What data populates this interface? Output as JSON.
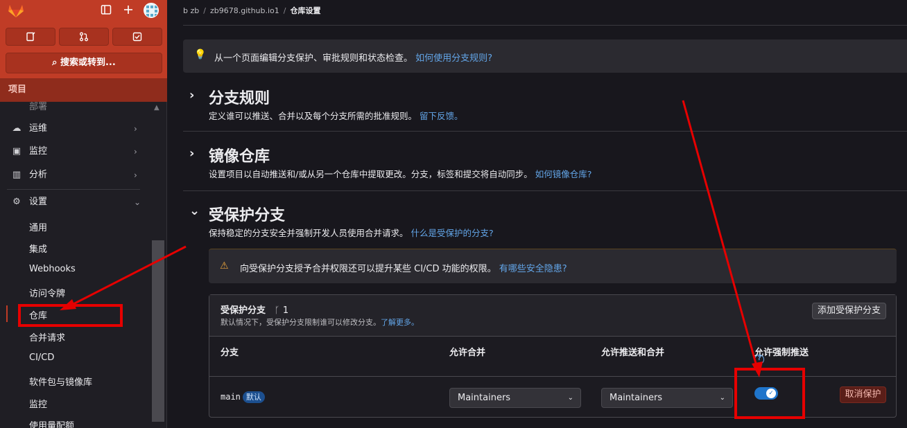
{
  "topbar": {
    "search_label": "搜索或转到...",
    "project_header": "项目"
  },
  "sidebar": {
    "cut_item": "部署",
    "items": [
      {
        "label": "运维",
        "icon": "cloud-ops-icon"
      },
      {
        "label": "监控",
        "icon": "monitor-icon"
      },
      {
        "label": "分析",
        "icon": "chart-icon"
      },
      {
        "label": "设置",
        "icon": "gear-icon"
      }
    ],
    "settings_sub": [
      "通用",
      "集成",
      "Webhooks",
      "访问令牌",
      "仓库",
      "合并请求",
      "CI/CD",
      "软件包与镜像库",
      "监控",
      "使用量配额"
    ],
    "active_sub": "仓库"
  },
  "breadcrumb": {
    "items": [
      "b zb",
      "zb9678.github.io1",
      "仓库设置"
    ]
  },
  "info_banner": {
    "text": "从一个页面编辑分支保护、审批规则和状态检查。",
    "link": "如何使用分支规则?"
  },
  "sections": {
    "branch_rules": {
      "title": "分支规则",
      "desc": "定义谁可以推送、合并以及每个分支所需的批准规则。",
      "link": "留下反馈。"
    },
    "mirror": {
      "title": "镜像仓库",
      "desc": "设置项目以自动推送和/或从另一个仓库中提取更改。分支，标签和提交将自动同步。",
      "link": "如何镜像仓库?"
    },
    "protected": {
      "title": "受保护分支",
      "desc": "保持稳定的分支安全并强制开发人员使用合并请求。",
      "link": "什么是受保护的分支?"
    }
  },
  "warning": {
    "text": "向受保护分支授予合并权限还可以提升某些 CI/CD 功能的权限。",
    "link": "有哪些安全隐患?"
  },
  "table": {
    "title": "受保护分支",
    "count": "1",
    "subtitle": "默认情况下，受保护分支限制谁可以修改分支。",
    "subtitle_link": "了解更多。",
    "add_button": "添加受保护分支",
    "headers": {
      "branch": "分支",
      "merge": "允许合并",
      "push_merge": "允许推送和合并",
      "force_push": "允许强制推送"
    },
    "rows": [
      {
        "branch": "main",
        "badge": "默认",
        "merge": "Maintainers",
        "push_merge": "Maintainers",
        "force_push": true,
        "action": "取消保护"
      }
    ]
  },
  "colors": {
    "brand": "#c03c26",
    "link": "#63a6e9",
    "toggle_on": "#1f75cb",
    "annotation": "#e60000"
  }
}
